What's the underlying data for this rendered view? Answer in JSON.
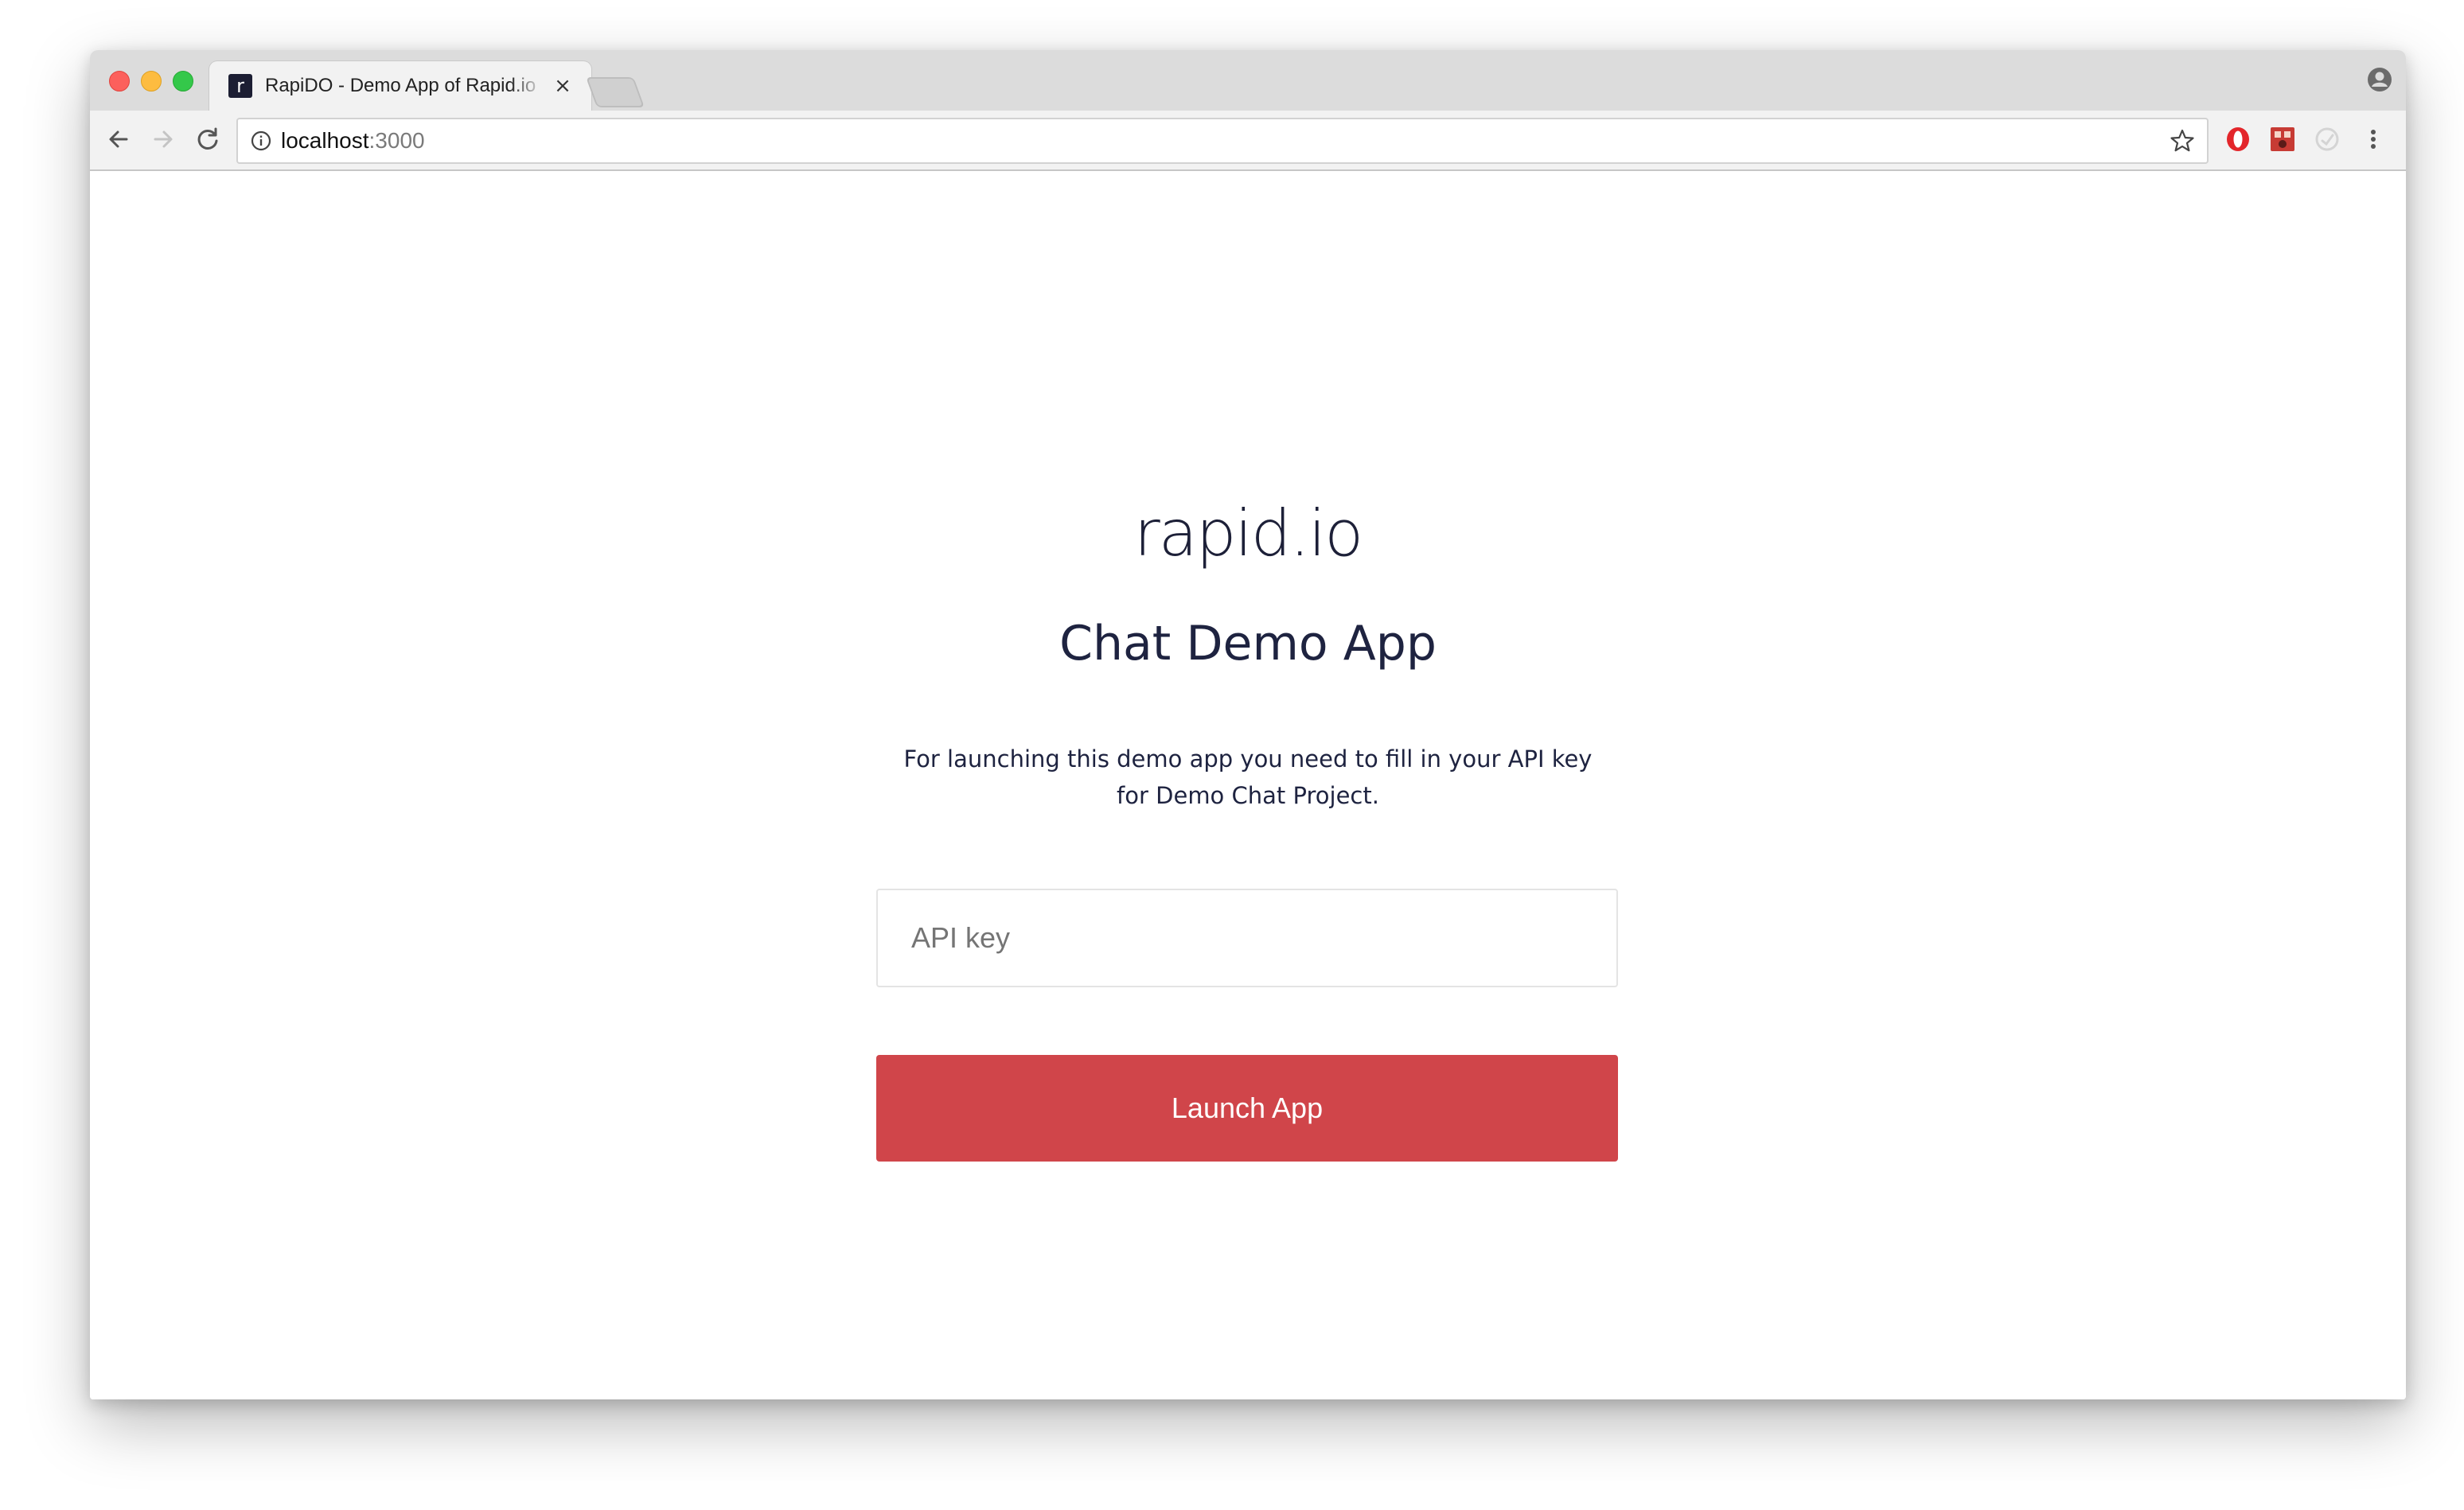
{
  "browser": {
    "tab": {
      "favicon_letter": "r",
      "title": "RapiDO - Demo App of Rapid.io",
      "close_glyph": "×"
    },
    "address_bar": {
      "host": "localhost",
      "port": ":3000"
    },
    "icons": {
      "back": "back-arrow-icon",
      "forward": "forward-arrow-icon",
      "reload": "reload-icon",
      "info": "info-icon",
      "bookmark": "star-icon",
      "extensions": [
        "opera-icon",
        "extension-icon",
        "extension-icon"
      ],
      "menu": "kebab-menu-icon",
      "profile": "profile-icon"
    }
  },
  "page": {
    "logo": "rapid.io",
    "title": "Chat Demo App",
    "description": "For launching this demo app you need to fill in your API key for Demo Chat Project.",
    "api_input": {
      "placeholder": "API key",
      "value": ""
    },
    "launch_button": "Launch App"
  },
  "colors": {
    "accent": "#d0454a",
    "text_dark": "#1e2340"
  }
}
